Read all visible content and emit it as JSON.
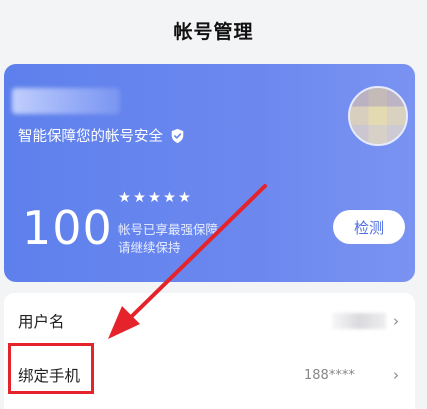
{
  "header": {
    "title": "帐号管理"
  },
  "card": {
    "slogan": "智能保障您的帐号安全",
    "score": "100",
    "stars": "★★★★★",
    "stars_count": 5,
    "desc_line1": "帐号已享最强保障",
    "desc_line2": "请继续保持",
    "detect_label": "检测",
    "accent_color": "#6a86ee"
  },
  "list": {
    "rows": [
      {
        "label": "用户名",
        "value": ""
      },
      {
        "label": "绑定手机",
        "value": "188****"
      }
    ],
    "chevron": "›"
  },
  "annotation": {
    "highlight_color": "#e5232b"
  }
}
